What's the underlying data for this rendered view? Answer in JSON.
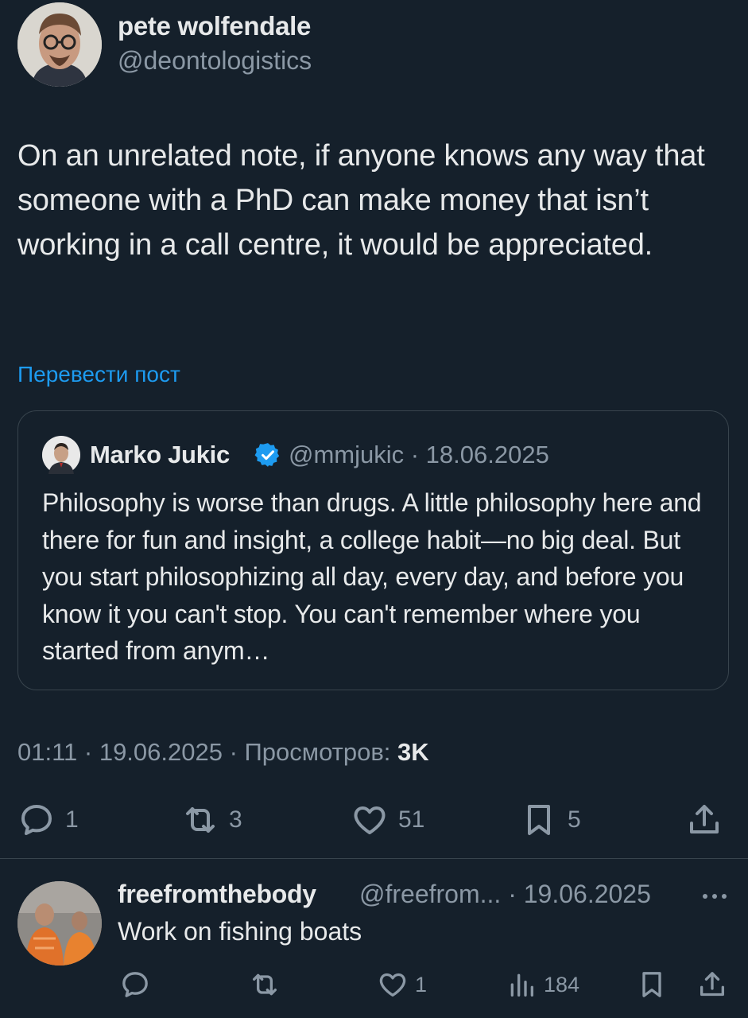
{
  "author": {
    "name": "pete wolfendale",
    "handle": "@deontologistics"
  },
  "tweet": {
    "text": "On an unrelated note, if anyone knows any way that someone with a PhD can make money that isn’t working in a call centre, it would be appreciated.",
    "translate_label": "Перевести пост"
  },
  "quote": {
    "name": "Marko Jukic",
    "meta": "@mmjukic · 18.06.2025",
    "text": "Philosophy is worse than drugs. A little philosophy here and there for fun and insight, a college habit—no big deal. But you start philosophizing all day, every day, and before you know it you can't stop. You can't remember where you started from anym…"
  },
  "timestamp": {
    "prefix": "01:11 · 19.06.2025 · Просмотров: ",
    "views": "3K"
  },
  "actions": {
    "replies": "1",
    "reposts": "3",
    "likes": "51",
    "bookmarks": "5"
  },
  "reply": {
    "name": "freefromthebody",
    "meta": "@freefrom... · 19.06.2025",
    "text": "Work on fishing boats",
    "likes": "1",
    "views": "184"
  },
  "colors": {
    "background": "#15202b",
    "accent": "#1d9bf0",
    "secondary_text": "#8b98a5",
    "border": "#38444d"
  }
}
